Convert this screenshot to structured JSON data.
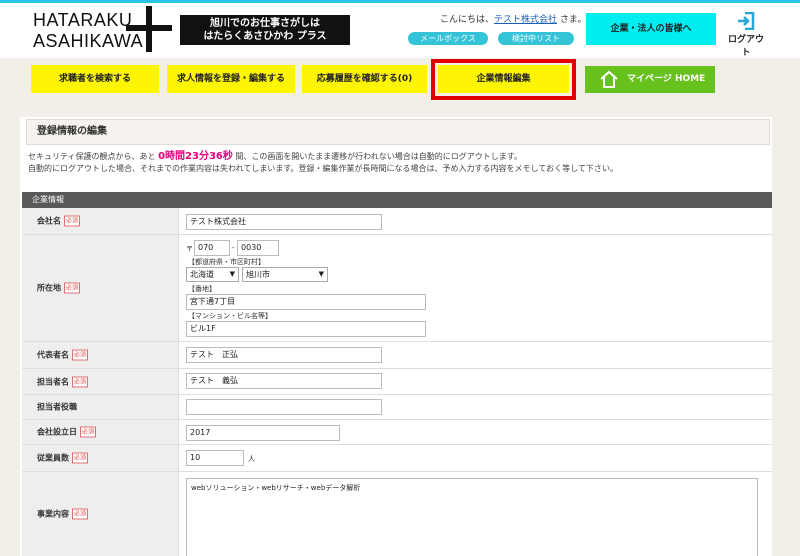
{
  "logo": {
    "line1": "HATARAKU",
    "line2": "ASAHIKAWA",
    "tag_line1": "旭川でのお仕事さがしは",
    "tag_line2": "はたらくあさひかわ プラス"
  },
  "header": {
    "greeting_pre": "こんにちは、",
    "company": "テスト株式会社",
    "greeting_post": " さま。",
    "mailbox": "メールボックス",
    "review_list": "検討中リスト",
    "corp_button": "企業・法人の皆様へ",
    "logout": "ログアウト"
  },
  "nav": {
    "items": [
      "求職者を検索する",
      "求人情報を登録・編集する",
      "応募履歴を確認する(0)",
      "企業情報編集"
    ],
    "mypage": "マイページ HOME"
  },
  "page": {
    "title": "登録情報の編集",
    "notice1_pre": "セキュリティ保護の観点から、あと",
    "timer": "0時間23分36秒",
    "notice1_post": "間、この画面を開いたまま遷移が行われない場合は自動的にログアウトします。",
    "notice2": "自動的にログアウトした場合、それまでの作業内容は失われてしまいます。登録・編集作業が長時間になる場合は、予め入力する内容をメモしておく等して下さい。"
  },
  "form": {
    "section": "企業情報",
    "required": "必須",
    "company_label": "会社名",
    "company_value": "テスト株式会社",
    "address_label": "所在地",
    "postal_mark": "〒",
    "postal1": "070",
    "postal_dash": "-",
    "postal2": "0030",
    "pref_city_hint": "【都道府県・市区町村】",
    "prefecture": "北海道",
    "city": "旭川市",
    "street_hint": "【番地】",
    "street": "宮下通7丁目",
    "building_hint": "【マンション・ビル名等】",
    "building": "ビル1F",
    "rep_label": "代表者名",
    "rep_value": "テスト　正弘",
    "contact_label": "担当者名",
    "contact_value": "テスト　義弘",
    "contact_role_label": "担当者役職",
    "contact_role_value": "",
    "founded_label": "会社設立日",
    "founded_value": "2017",
    "employees_label": "従業員数",
    "employees_value": "10",
    "employees_unit": "人",
    "business_label": "事業内容",
    "business_value": "webソリューション・webリサーチ・webデータ解析"
  },
  "colors": {
    "accent": "#29c5e6",
    "nav_yellow": "#fdf504",
    "highlight": "#e00000",
    "mypage_green": "#67c21e",
    "timer": "#e4007f"
  }
}
